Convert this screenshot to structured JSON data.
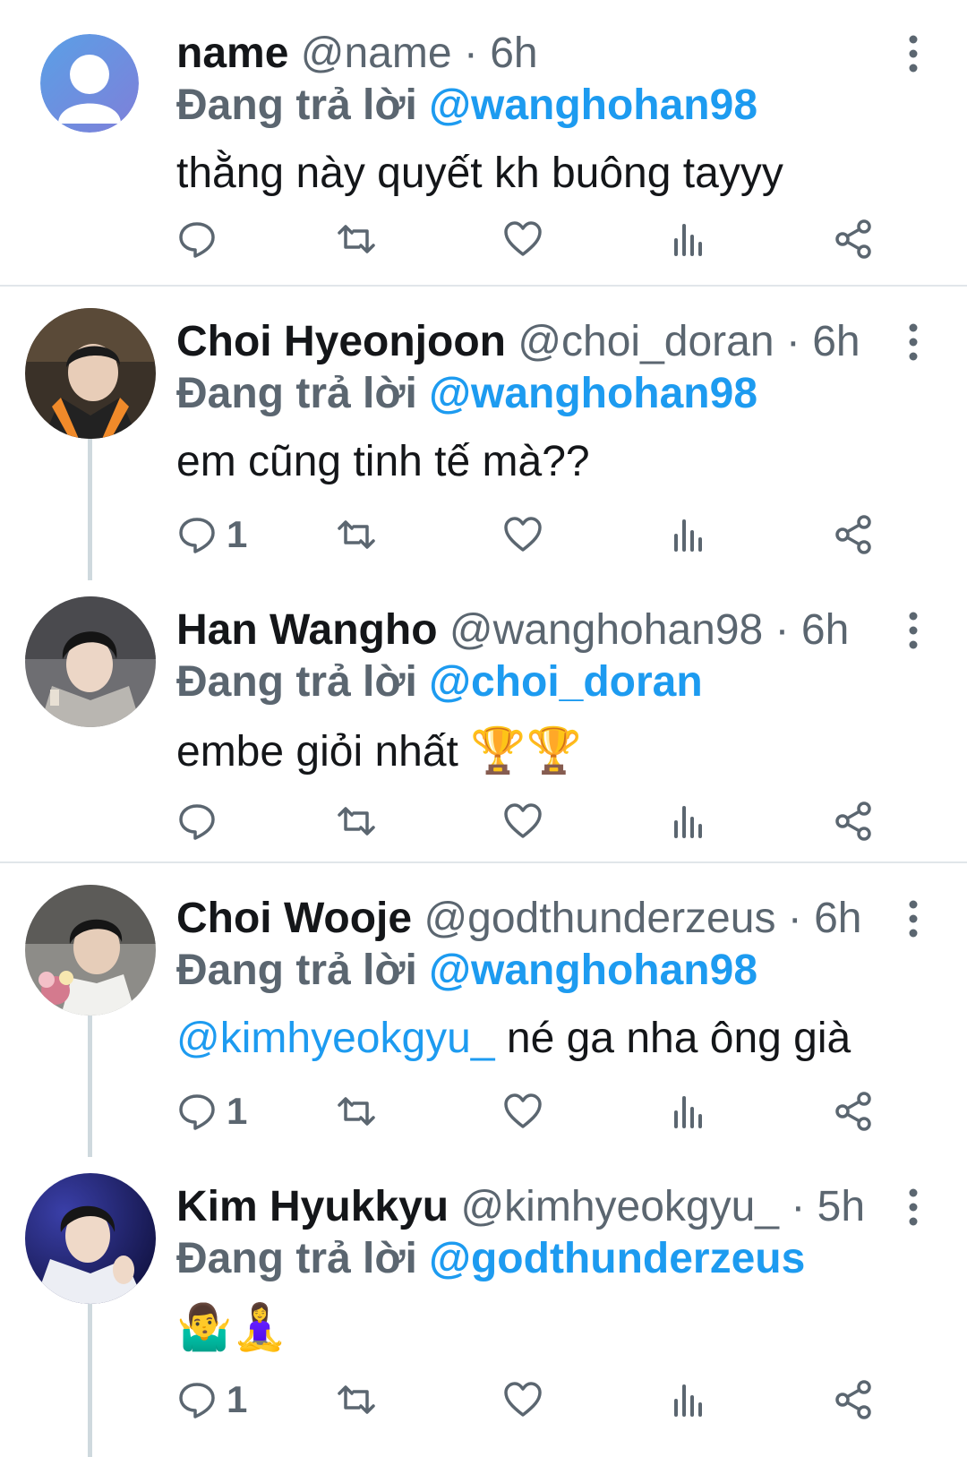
{
  "theme": {
    "accent": "#1d9bf0",
    "muted": "#5b6670",
    "text": "#141619",
    "divider": "#e1e6ea",
    "thread": "#cfd9de"
  },
  "tweets": [
    {
      "name": "name",
      "handle": "@name",
      "dot": "·",
      "time": "6h",
      "reply_label": "Đang trả lời",
      "reply_to": "@wanghohan98",
      "text": "thằng này quyết kh buông tayyy",
      "reply_count": "",
      "avatar": "default-avatar"
    },
    {
      "name": "Choi Hyeonjoon",
      "handle": "@choi_doran",
      "dot": "·",
      "time": "6h",
      "reply_label": "Đang trả lời",
      "reply_to": "@wanghohan98",
      "text": "em cũng tinh tế mà??",
      "reply_count": "1",
      "avatar": "photo-avatar"
    },
    {
      "name": "Han Wangho",
      "handle": "@wanghohan98",
      "dot": "·",
      "time": "6h",
      "reply_label": "Đang trả lời",
      "reply_to": "@choi_doran",
      "text": "embe giỏi nhất",
      "text_emoji": "🏆🏆",
      "reply_count": "",
      "avatar": "photo-avatar"
    },
    {
      "name": "Choi Wooje",
      "handle": "@godthunderzeus",
      "dot": "·",
      "time": "6h",
      "reply_label": "Đang trả lời",
      "reply_to": "@wanghohan98",
      "text_mention": "@kimhyeokgyu_",
      "text": " né ga nha ông già",
      "reply_count": "1",
      "avatar": "photo-avatar"
    },
    {
      "name": "Kim Hyukkyu",
      "handle": "@kimhyeokgyu_",
      "dot": "·",
      "time": "5h",
      "reply_label": "Đang trả lời",
      "reply_to": "@godthunderzeus",
      "text_emoji": "🤷‍♂️🧘‍♀️",
      "reply_count": "1",
      "avatar": "photo-avatar"
    }
  ],
  "icons": {
    "reply": "reply-icon",
    "retweet": "retweet-icon",
    "like": "heart-icon",
    "views": "views-icon",
    "share": "share-icon",
    "more": "more-vertical-icon"
  }
}
